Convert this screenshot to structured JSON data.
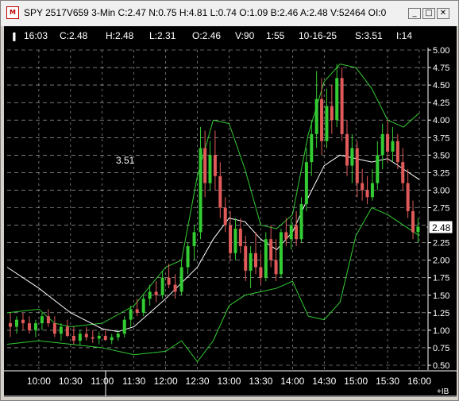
{
  "window": {
    "title": "SPY 2517V659 3-Min C:2.47 N:0.75 H:4.81 L:0.74 O:1.09 B:2.46 A:2.48 V:52464 OI:0",
    "icon_name": "chart-app-icon",
    "minimize_glyph": "_",
    "maximize_glyph": "□",
    "close_glyph": "✕"
  },
  "infobar": {
    "marker": "▐",
    "time": "16:03",
    "close": "C:2.48",
    "high": "H:2.48",
    "low": "L:2.31",
    "open": "O:2.46",
    "volume": "V:90",
    "interval": "1:55",
    "date": "10-16-25",
    "s_value": "S:3.51",
    "i_value": "I:14"
  },
  "price_label": "3.51",
  "current_price_tag": "2.48",
  "corner_label": "+IB",
  "colors": {
    "background": "#000000",
    "up_candle": "#33cc33",
    "down_candle": "#e05a5a",
    "bollinger": "#33cc33",
    "moving_average": "#ffffff",
    "grid": "#ffffff"
  },
  "chart_data": {
    "type": "candlestick",
    "ylim": [
      0.5,
      5.0
    ],
    "y_ticks": [
      "5.00",
      "4.75",
      "4.50",
      "4.25",
      "4.00",
      "3.75",
      "3.50",
      "3.25",
      "3.00",
      "2.75",
      "2.50",
      "2.25",
      "2.00",
      "1.75",
      "1.50",
      "1.25",
      "1.00",
      "0.75",
      "0.50"
    ],
    "x_ticks": [
      "10:00",
      "10:30",
      "11:00",
      "11:30",
      "12:00",
      "12:30",
      "13:00",
      "13:30",
      "14:00",
      "14:30",
      "15:00",
      "15:30",
      "16:00"
    ],
    "ma": [
      [
        9.5,
        1.9
      ],
      [
        10.0,
        1.6
      ],
      [
        10.5,
        1.25
      ],
      [
        11.0,
        1.02
      ],
      [
        11.25,
        0.98
      ],
      [
        11.5,
        1.05
      ],
      [
        12.0,
        1.45
      ],
      [
        12.5,
        1.9
      ],
      [
        12.75,
        2.3
      ],
      [
        13.0,
        2.6
      ],
      [
        13.25,
        2.55
      ],
      [
        13.5,
        2.3
      ],
      [
        13.75,
        2.15
      ],
      [
        14.0,
        2.4
      ],
      [
        14.25,
        2.9
      ],
      [
        14.5,
        3.35
      ],
      [
        14.75,
        3.5
      ],
      [
        15.0,
        3.45
      ],
      [
        15.25,
        3.4
      ],
      [
        15.5,
        3.45
      ],
      [
        15.75,
        3.3
      ],
      [
        16.0,
        3.15
      ]
    ],
    "bb_upper": [
      [
        9.5,
        1.25
      ],
      [
        10.0,
        1.3
      ],
      [
        10.25,
        1.1
      ],
      [
        10.5,
        1.05
      ],
      [
        11.0,
        1.1
      ],
      [
        11.5,
        1.35
      ],
      [
        12.0,
        1.9
      ],
      [
        12.25,
        2.0
      ],
      [
        12.5,
        3.2
      ],
      [
        12.75,
        4.0
      ],
      [
        13.0,
        3.95
      ],
      [
        13.25,
        3.3
      ],
      [
        13.5,
        2.5
      ],
      [
        13.75,
        2.45
      ],
      [
        14.0,
        2.65
      ],
      [
        14.25,
        3.8
      ],
      [
        14.5,
        4.55
      ],
      [
        14.75,
        4.8
      ],
      [
        15.0,
        4.75
      ],
      [
        15.25,
        4.45
      ],
      [
        15.5,
        4.0
      ],
      [
        15.75,
        3.9
      ],
      [
        16.0,
        4.1
      ]
    ],
    "bb_lower": [
      [
        9.5,
        0.8
      ],
      [
        10.0,
        0.85
      ],
      [
        10.5,
        0.8
      ],
      [
        11.0,
        0.75
      ],
      [
        11.5,
        0.65
      ],
      [
        12.0,
        0.7
      ],
      [
        12.25,
        0.85
      ],
      [
        12.5,
        0.55
      ],
      [
        12.75,
        0.85
      ],
      [
        13.0,
        1.35
      ],
      [
        13.25,
        1.5
      ],
      [
        13.5,
        1.55
      ],
      [
        13.75,
        1.6
      ],
      [
        14.0,
        1.7
      ],
      [
        14.25,
        1.2
      ],
      [
        14.5,
        1.15
      ],
      [
        14.75,
        1.4
      ],
      [
        15.0,
        2.35
      ],
      [
        15.25,
        2.75
      ],
      [
        15.5,
        2.65
      ],
      [
        15.75,
        2.5
      ],
      [
        16.0,
        2.35
      ]
    ],
    "candles": [
      {
        "t": 9.55,
        "o": 1.1,
        "h": 1.25,
        "l": 0.9,
        "c": 1.05
      },
      {
        "t": 9.65,
        "o": 1.05,
        "h": 1.2,
        "l": 0.95,
        "c": 1.15
      },
      {
        "t": 9.75,
        "o": 1.15,
        "h": 1.25,
        "l": 1.0,
        "c": 1.1
      },
      {
        "t": 9.85,
        "o": 1.1,
        "h": 1.2,
        "l": 0.95,
        "c": 1.0
      },
      {
        "t": 9.95,
        "o": 1.0,
        "h": 1.15,
        "l": 0.9,
        "c": 1.1
      },
      {
        "t": 10.05,
        "o": 1.1,
        "h": 1.25,
        "l": 1.0,
        "c": 1.2
      },
      {
        "t": 10.15,
        "o": 1.2,
        "h": 1.3,
        "l": 1.05,
        "c": 1.1
      },
      {
        "t": 10.25,
        "o": 1.1,
        "h": 1.2,
        "l": 0.9,
        "c": 0.95
      },
      {
        "t": 10.35,
        "o": 0.95,
        "h": 1.1,
        "l": 0.85,
        "c": 1.05
      },
      {
        "t": 10.45,
        "o": 1.05,
        "h": 1.15,
        "l": 0.9,
        "c": 0.92
      },
      {
        "t": 10.55,
        "o": 0.92,
        "h": 1.05,
        "l": 0.8,
        "c": 0.85
      },
      {
        "t": 10.65,
        "o": 0.85,
        "h": 1.0,
        "l": 0.78,
        "c": 0.95
      },
      {
        "t": 10.75,
        "o": 0.95,
        "h": 1.05,
        "l": 0.85,
        "c": 0.9
      },
      {
        "t": 10.85,
        "o": 0.9,
        "h": 1.0,
        "l": 0.82,
        "c": 0.88
      },
      {
        "t": 10.95,
        "o": 0.88,
        "h": 0.98,
        "l": 0.8,
        "c": 0.92
      },
      {
        "t": 11.05,
        "o": 0.92,
        "h": 1.0,
        "l": 0.85,
        "c": 0.86
      },
      {
        "t": 11.15,
        "o": 0.86,
        "h": 0.95,
        "l": 0.8,
        "c": 0.9
      },
      {
        "t": 11.25,
        "o": 0.9,
        "h": 1.0,
        "l": 0.85,
        "c": 0.95
      },
      {
        "t": 11.35,
        "o": 0.95,
        "h": 1.2,
        "l": 0.9,
        "c": 1.15
      },
      {
        "t": 11.45,
        "o": 1.15,
        "h": 1.35,
        "l": 1.05,
        "c": 1.3
      },
      {
        "t": 11.55,
        "o": 1.3,
        "h": 1.45,
        "l": 1.2,
        "c": 1.25
      },
      {
        "t": 11.65,
        "o": 1.25,
        "h": 1.5,
        "l": 1.2,
        "c": 1.45
      },
      {
        "t": 11.75,
        "o": 1.45,
        "h": 1.65,
        "l": 1.35,
        "c": 1.55
      },
      {
        "t": 11.85,
        "o": 1.55,
        "h": 1.7,
        "l": 1.4,
        "c": 1.5
      },
      {
        "t": 11.95,
        "o": 1.5,
        "h": 1.85,
        "l": 1.45,
        "c": 1.75
      },
      {
        "t": 12.05,
        "o": 1.75,
        "h": 1.95,
        "l": 1.6,
        "c": 1.65
      },
      {
        "t": 12.15,
        "o": 1.65,
        "h": 1.8,
        "l": 1.45,
        "c": 1.55
      },
      {
        "t": 12.25,
        "o": 1.55,
        "h": 2.0,
        "l": 1.5,
        "c": 1.9
      },
      {
        "t": 12.35,
        "o": 1.9,
        "h": 2.25,
        "l": 1.8,
        "c": 2.2
      },
      {
        "t": 12.45,
        "o": 2.2,
        "h": 2.5,
        "l": 2.0,
        "c": 2.4
      },
      {
        "t": 12.55,
        "o": 2.4,
        "h": 3.9,
        "l": 2.3,
        "c": 3.6
      },
      {
        "t": 12.62,
        "o": 3.6,
        "h": 3.85,
        "l": 2.9,
        "c": 3.1
      },
      {
        "t": 12.7,
        "o": 3.1,
        "h": 3.7,
        "l": 3.0,
        "c": 3.5
      },
      {
        "t": 12.78,
        "o": 3.5,
        "h": 3.85,
        "l": 3.0,
        "c": 3.2
      },
      {
        "t": 12.86,
        "o": 3.2,
        "h": 3.4,
        "l": 2.6,
        "c": 2.75
      },
      {
        "t": 12.94,
        "o": 2.75,
        "h": 2.9,
        "l": 2.4,
        "c": 2.5
      },
      {
        "t": 13.02,
        "o": 2.5,
        "h": 2.7,
        "l": 2.0,
        "c": 2.1
      },
      {
        "t": 13.1,
        "o": 2.1,
        "h": 2.6,
        "l": 2.0,
        "c": 2.45
      },
      {
        "t": 13.18,
        "o": 2.45,
        "h": 2.6,
        "l": 2.1,
        "c": 2.2
      },
      {
        "t": 13.26,
        "o": 2.2,
        "h": 2.35,
        "l": 1.7,
        "c": 1.85
      },
      {
        "t": 13.34,
        "o": 1.85,
        "h": 2.2,
        "l": 1.6,
        "c": 2.1
      },
      {
        "t": 13.42,
        "o": 2.1,
        "h": 2.4,
        "l": 1.8,
        "c": 1.9
      },
      {
        "t": 13.5,
        "o": 1.9,
        "h": 2.1,
        "l": 1.65,
        "c": 1.75
      },
      {
        "t": 13.58,
        "o": 1.75,
        "h": 2.4,
        "l": 1.7,
        "c": 2.3
      },
      {
        "t": 13.66,
        "o": 2.3,
        "h": 2.5,
        "l": 1.9,
        "c": 2.0
      },
      {
        "t": 13.74,
        "o": 2.0,
        "h": 2.3,
        "l": 1.7,
        "c": 1.8
      },
      {
        "t": 13.82,
        "o": 1.8,
        "h": 2.45,
        "l": 1.75,
        "c": 2.4
      },
      {
        "t": 13.9,
        "o": 2.4,
        "h": 2.6,
        "l": 2.2,
        "c": 2.3
      },
      {
        "t": 13.98,
        "o": 2.3,
        "h": 2.6,
        "l": 2.15,
        "c": 2.5
      },
      {
        "t": 14.06,
        "o": 2.5,
        "h": 2.7,
        "l": 2.2,
        "c": 2.3
      },
      {
        "t": 14.14,
        "o": 2.3,
        "h": 2.9,
        "l": 2.25,
        "c": 2.8
      },
      {
        "t": 14.22,
        "o": 2.8,
        "h": 3.6,
        "l": 2.7,
        "c": 3.4
      },
      {
        "t": 14.3,
        "o": 3.4,
        "h": 4.0,
        "l": 3.2,
        "c": 3.8
      },
      {
        "t": 14.38,
        "o": 3.8,
        "h": 4.7,
        "l": 3.6,
        "c": 4.3
      },
      {
        "t": 14.46,
        "o": 4.3,
        "h": 4.6,
        "l": 3.5,
        "c": 3.7
      },
      {
        "t": 14.54,
        "o": 3.7,
        "h": 4.45,
        "l": 3.6,
        "c": 4.2
      },
      {
        "t": 14.62,
        "o": 4.2,
        "h": 4.5,
        "l": 3.8,
        "c": 4.0
      },
      {
        "t": 14.7,
        "o": 4.0,
        "h": 4.8,
        "l": 3.9,
        "c": 4.6
      },
      {
        "t": 14.78,
        "o": 4.6,
        "h": 4.75,
        "l": 3.7,
        "c": 3.8
      },
      {
        "t": 14.86,
        "o": 3.8,
        "h": 4.0,
        "l": 3.2,
        "c": 3.35
      },
      {
        "t": 14.94,
        "o": 3.35,
        "h": 3.8,
        "l": 3.1,
        "c": 3.6
      },
      {
        "t": 15.02,
        "o": 3.6,
        "h": 3.7,
        "l": 2.9,
        "c": 3.1
      },
      {
        "t": 15.1,
        "o": 3.1,
        "h": 3.3,
        "l": 2.85,
        "c": 3.0
      },
      {
        "t": 15.18,
        "o": 3.0,
        "h": 3.2,
        "l": 2.8,
        "c": 2.9
      },
      {
        "t": 15.26,
        "o": 2.9,
        "h": 3.3,
        "l": 2.85,
        "c": 3.1
      },
      {
        "t": 15.34,
        "o": 3.1,
        "h": 3.7,
        "l": 3.0,
        "c": 3.5
      },
      {
        "t": 15.42,
        "o": 3.5,
        "h": 3.95,
        "l": 3.3,
        "c": 3.8
      },
      {
        "t": 15.5,
        "o": 3.8,
        "h": 4.0,
        "l": 3.4,
        "c": 3.55
      },
      {
        "t": 15.58,
        "o": 3.55,
        "h": 3.9,
        "l": 3.4,
        "c": 3.7
      },
      {
        "t": 15.66,
        "o": 3.7,
        "h": 3.8,
        "l": 3.3,
        "c": 3.4
      },
      {
        "t": 15.74,
        "o": 3.4,
        "h": 3.6,
        "l": 3.0,
        "c": 3.1
      },
      {
        "t": 15.82,
        "o": 3.1,
        "h": 3.3,
        "l": 2.6,
        "c": 2.7
      },
      {
        "t": 15.9,
        "o": 2.7,
        "h": 2.85,
        "l": 2.3,
        "c": 2.4
      },
      {
        "t": 15.98,
        "o": 2.4,
        "h": 2.6,
        "l": 2.25,
        "c": 2.48
      }
    ]
  }
}
